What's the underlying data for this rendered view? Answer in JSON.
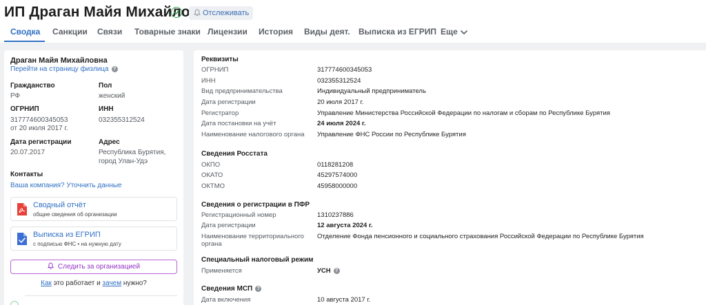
{
  "header": {
    "title": "ИП Драган Майя Михайловна",
    "follow_label": "Отслеживать"
  },
  "tabs": [
    {
      "label": "Сводка",
      "active": true
    },
    {
      "label": "Санкции"
    },
    {
      "label": "Связи"
    },
    {
      "label": "Товарные знаки"
    },
    {
      "label": "Лицензии"
    },
    {
      "label": "История"
    },
    {
      "label": "Виды деят."
    },
    {
      "label": "Выписка из ЕГРИП"
    },
    {
      "label": "Еще"
    }
  ],
  "left": {
    "name": "Драган Майя Михайловна",
    "person_link": "Перейти на страницу физлица",
    "citizenship_label": "Гражданство",
    "citizenship_value": "РФ",
    "gender_label": "Пол",
    "gender_value": "женский",
    "ogrnip_label": "ОГРНИП",
    "ogrnip_value": "317774600345053",
    "ogrnip_date": "от 20 июля 2017 г.",
    "inn_label": "ИНН",
    "inn_value": "032355312524",
    "reg_date_label": "Дата регистрации",
    "reg_date_value": "20.07.2017",
    "address_label": "Адрес",
    "address_line1": "Республика Бурятия,",
    "address_line2": "город Улан-Удэ",
    "contacts_label": "Контакты",
    "contacts_link": "Ваша компания? Уточнить данные",
    "report_title": "Сводный отчёт",
    "report_sub": "общие сведения об организации",
    "extract_title": "Выписка из ЕГРИП",
    "extract_sub": "с подписью ФНС • на нужную дату",
    "follow_org": "Следить за организацией",
    "how_link1": "Как",
    "how_text1": " это работает и ",
    "how_link2": "зачем",
    "how_text2": " нужно?"
  },
  "right": {
    "requisites": {
      "title": "Реквизиты",
      "rows": [
        {
          "label": "ОГРНИП",
          "value": "317774600345053"
        },
        {
          "label": "ИНН",
          "value": "032355312524"
        },
        {
          "label": "Вид предпринимательства",
          "value": "Индивидуальный предприниматель"
        },
        {
          "label": "Дата регистрации",
          "value": "20 июля 2017 г."
        },
        {
          "label": "Регистратор",
          "value": "Управление Министерства Российской Федерации по налогам и сборам по Республике Бурятия"
        },
        {
          "label": "Дата постановки на учёт",
          "value": "24 июля 2024 г."
        },
        {
          "label": "Наименование налогового органа",
          "value": "Управление ФНС России по Республике Бурятия"
        }
      ]
    },
    "rosstat": {
      "title": "Сведения Росстата",
      "rows": [
        {
          "label": "ОКПО",
          "value": "0118281208"
        },
        {
          "label": "ОКАТО",
          "value": "45297574000"
        },
        {
          "label": "ОКТМО",
          "value": "45958000000"
        }
      ]
    },
    "pfr": {
      "title": "Сведения о регистрации в ПФР",
      "rows": [
        {
          "label": "Регистрационный номер",
          "value": "1310237886"
        },
        {
          "label": "Дата регистрации",
          "value": "12 августа 2024 г."
        },
        {
          "label_line1": "Наименование территориального",
          "label_line2": "органа",
          "value": "Отделение Фонда пенсионного и социального страхования Российской Федерации по Республике Бурятия"
        }
      ]
    },
    "tax_regime": {
      "title": "Специальный налоговый режим",
      "rows": [
        {
          "label": "Применяется",
          "value": "УСН"
        }
      ]
    },
    "msp": {
      "title": "Сведения МСП",
      "rows": [
        {
          "label": "Дата включения",
          "value": "10 августа 2017 г."
        }
      ]
    }
  }
}
